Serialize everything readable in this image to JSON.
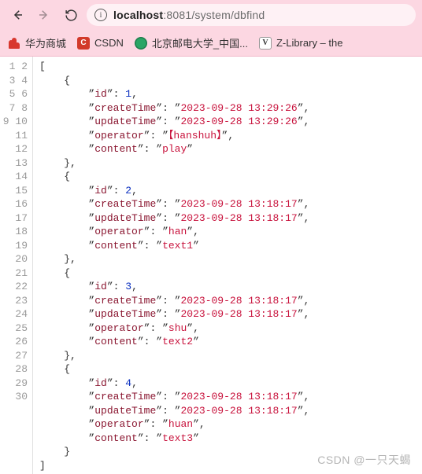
{
  "toolbar": {
    "back_title": "Back",
    "forward_title": "Forward",
    "reload_title": "Reload"
  },
  "address": {
    "info_title": "View site information",
    "host_main": "localhost",
    "host_rest": ":8081",
    "path": "/system/dbfind"
  },
  "bookmarks": {
    "items": [
      {
        "label": "华为商城"
      },
      {
        "label": "CSDN"
      },
      {
        "label": "北京邮电大学_中国..."
      },
      {
        "label": "Z-Library – the"
      }
    ]
  },
  "code": {
    "line_count": 30,
    "records": [
      {
        "id": 1,
        "createTime": "2023-09-28 13:29:26",
        "updateTime": "2023-09-28 13:29:26",
        "operator": "【hanshuh】",
        "content": "play"
      },
      {
        "id": 2,
        "createTime": "2023-09-28 13:18:17",
        "updateTime": "2023-09-28 13:18:17",
        "operator": "han",
        "content": "text1"
      },
      {
        "id": 3,
        "createTime": "2023-09-28 13:18:17",
        "updateTime": "2023-09-28 13:18:17",
        "operator": "shu",
        "content": "text2"
      },
      {
        "id": 4,
        "createTime": "2023-09-28 13:18:17",
        "updateTime": "2023-09-28 13:18:17",
        "operator": "huan",
        "content": "text3"
      }
    ],
    "q": "”",
    "qo": "“"
  },
  "watermark": "CSDN @一只天蝎"
}
